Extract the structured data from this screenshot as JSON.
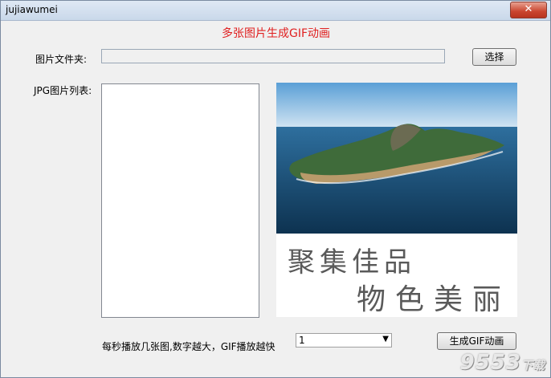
{
  "window": {
    "title": "jujiawumei",
    "close_glyph": "✕"
  },
  "app": {
    "heading": "多张图片生成GIF动画"
  },
  "folder": {
    "label": "图片文件夹:",
    "value": ""
  },
  "buttons": {
    "select_label": "选择",
    "generate_label": "生成GIF动画"
  },
  "list": {
    "label": "JPG图片列表:",
    "items": []
  },
  "preview": {
    "calligraphy_line1": "聚集佳品",
    "calligraphy_line2": "物色美丽"
  },
  "speed": {
    "label": "每秒播放几张图,数字越大，GIF播放越快",
    "value": "1",
    "arrow": "▼"
  },
  "watermark": {
    "main": "9553",
    "sub": "下载"
  }
}
